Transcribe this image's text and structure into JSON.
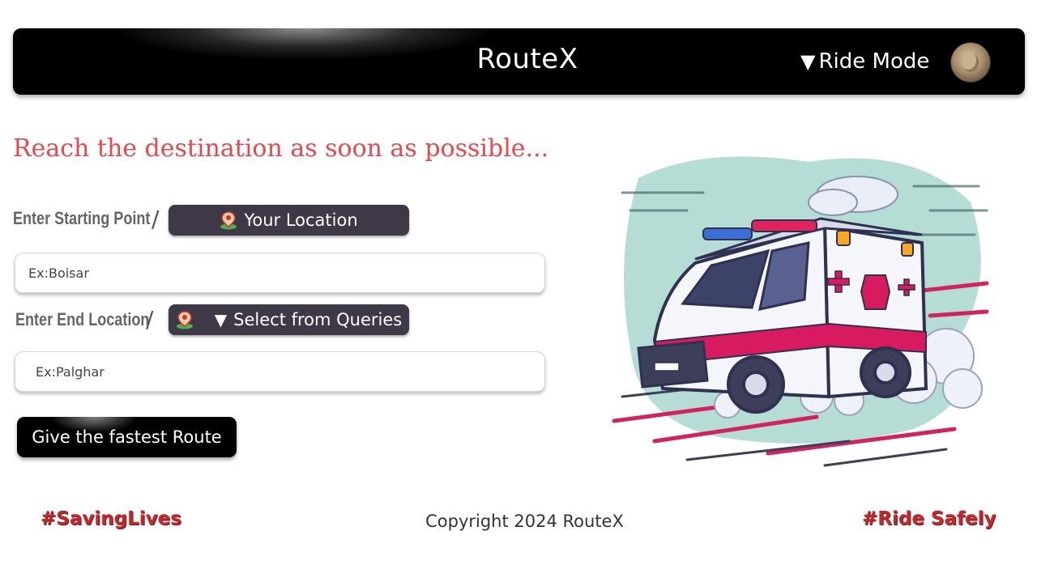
{
  "header": {
    "brand": "RouteX",
    "ride_mode_label": "Ride Mode",
    "ride_mode_icon": "triangle-down-icon"
  },
  "main": {
    "headline": "Reach the destination as soon as possible...",
    "start": {
      "label": "Enter Starting Point",
      "separator": "/",
      "location_button": "Your Location",
      "placeholder": "Ex:Boisar"
    },
    "end": {
      "label": "Enter End Location",
      "separator": "/",
      "queries_button": "Select from Queries",
      "placeholder": "Ex:Palghar"
    },
    "submit_label": "Give the fastest Route"
  },
  "footer": {
    "left_tag": "#SavingLives",
    "copyright": "Copyright 2024 RouteX",
    "right_tag": "#Ride Safely"
  },
  "colors": {
    "headline": "#e8484c",
    "navbar": "#000000",
    "pill": "#3e3847",
    "footer_tag": "#c0282e"
  }
}
